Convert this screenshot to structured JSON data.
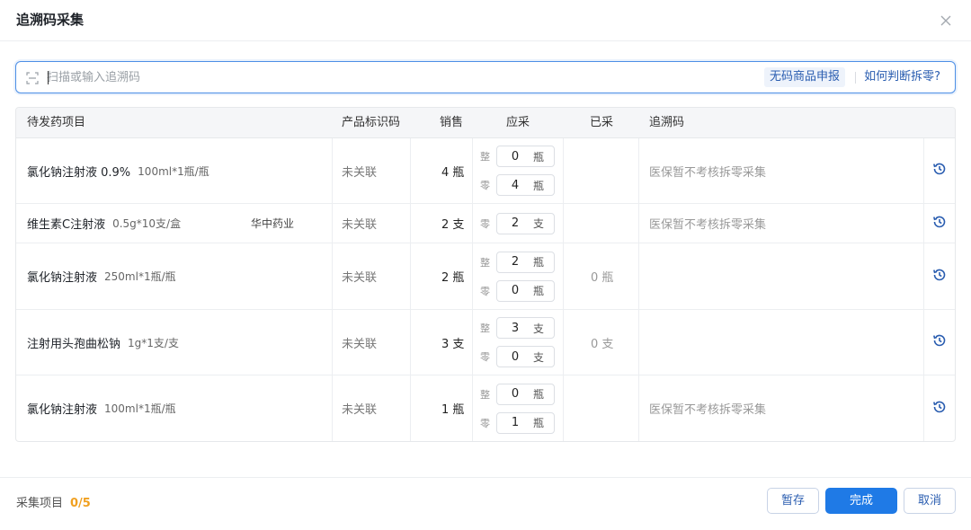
{
  "dialog": {
    "title": "追溯码采集"
  },
  "search": {
    "placeholder": "扫描或输入追溯码",
    "nocode_button": "无码商品申报",
    "howto_link": "如何判断拆零?"
  },
  "table": {
    "headers": {
      "item": "待发药项目",
      "product_id": "产品标识码",
      "sales": "销售",
      "should": "应采",
      "collected": "已采",
      "trace": "追溯码"
    },
    "rows": [
      {
        "name": "氯化钠注射液 0.9%",
        "spec": "100ml*1瓶/瓶",
        "maker": "",
        "product_code": "未关联",
        "sales": "4 瓶",
        "qty": [
          {
            "label": "整",
            "value": "0",
            "unit": "瓶"
          },
          {
            "label": "零",
            "value": "4",
            "unit": "瓶"
          }
        ],
        "collected": "",
        "trace": "医保暂不考核拆零采集"
      },
      {
        "name": "维生素C注射液",
        "spec": "0.5g*10支/盒",
        "maker": "华中药业",
        "product_code": "未关联",
        "sales": "2 支",
        "qty": [
          {
            "label": "零",
            "value": "2",
            "unit": "支"
          }
        ],
        "collected": "",
        "trace": "医保暂不考核拆零采集"
      },
      {
        "name": "氯化钠注射液",
        "spec": "250ml*1瓶/瓶",
        "maker": "",
        "product_code": "未关联",
        "sales": "2 瓶",
        "qty": [
          {
            "label": "整",
            "value": "2",
            "unit": "瓶"
          },
          {
            "label": "零",
            "value": "0",
            "unit": "瓶"
          }
        ],
        "collected": "0 瓶",
        "trace": ""
      },
      {
        "name": "注射用头孢曲松钠",
        "spec": "1g*1支/支",
        "maker": "",
        "product_code": "未关联",
        "sales": "3 支",
        "qty": [
          {
            "label": "整",
            "value": "3",
            "unit": "支"
          },
          {
            "label": "零",
            "value": "0",
            "unit": "支"
          }
        ],
        "collected": "0 支",
        "trace": ""
      },
      {
        "name": "氯化钠注射液",
        "spec": "100ml*1瓶/瓶",
        "maker": "",
        "product_code": "未关联",
        "sales": "1 瓶",
        "qty": [
          {
            "label": "整",
            "value": "0",
            "unit": "瓶"
          },
          {
            "label": "零",
            "value": "1",
            "unit": "瓶"
          }
        ],
        "collected": "",
        "trace": "医保暂不考核拆零采集"
      }
    ]
  },
  "footer": {
    "label": "采集项目",
    "count": "0/5",
    "save": "暂存",
    "done": "完成",
    "cancel": "取消"
  },
  "colors": {
    "accent": "#1f7ae6",
    "link": "#2a5db0",
    "count": "#f0a020"
  }
}
